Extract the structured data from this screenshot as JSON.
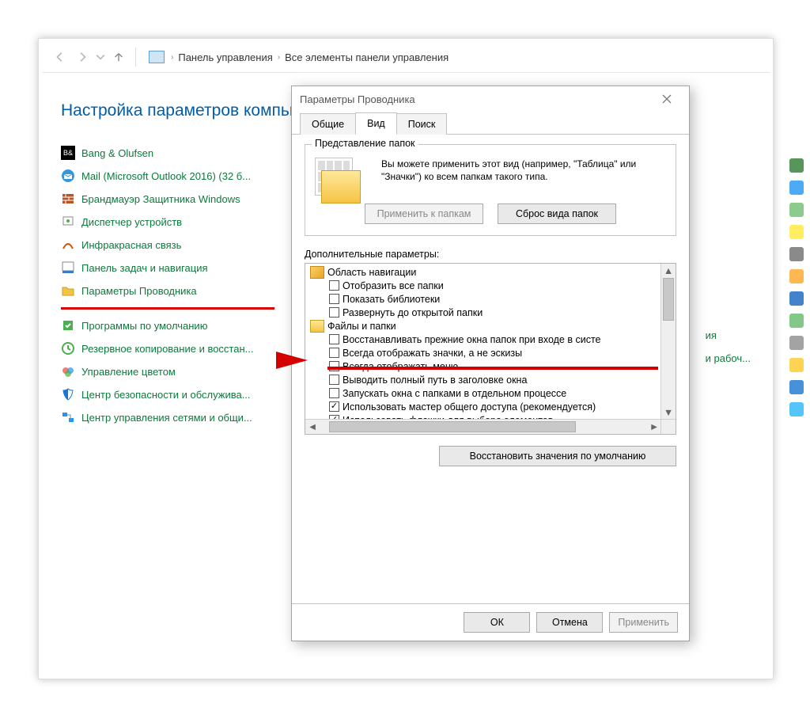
{
  "breadcrumbs": {
    "level1": "Панель управления",
    "level2": "Все элементы панели управления"
  },
  "cp": {
    "heading": "Настройка параметров компьют",
    "links": [
      "Bang & Olufsen",
      "Mail (Microsoft Outlook 2016) (32 б...",
      "Брандмауэр Защитника Windows",
      "Диспетчер устройств",
      "Инфракрасная связь",
      "Панель задач и навигация",
      "Параметры Проводника",
      "Программы по умолчанию",
      "Резервное копирование и восстан...",
      "Управление цветом",
      "Центр безопасности и обслужива...",
      "Центр управления сетями и общи..."
    ],
    "right_cutoff_1": "ия",
    "right_cutoff_2": "и рабоч..."
  },
  "dialog": {
    "title": "Параметры Проводника",
    "tabs": {
      "general": "Общие",
      "view": "Вид",
      "search": "Поиск"
    },
    "group": {
      "legend": "Представление папок",
      "desc": "Вы можете применить этот вид (например, \"Таблица\" или \"Значки\") ко всем папкам такого типа.",
      "apply_btn": "Применить к папкам",
      "reset_btn": "Сброс вида папок"
    },
    "adv_label": "Дополнительные параметры:",
    "tree": {
      "group_nav": "Область навигации",
      "items_nav": [
        {
          "checked": false,
          "label": "Отобразить все папки"
        },
        {
          "checked": false,
          "label": "Показать библиотеки"
        },
        {
          "checked": false,
          "label": "Развернуть до открытой папки"
        }
      ],
      "group_files": "Файлы и папки",
      "items_files": [
        {
          "checked": false,
          "label": "Восстанавливать прежние окна папок при входе в систе"
        },
        {
          "checked": false,
          "label": "Всегда отображать значки, а не эскизы"
        },
        {
          "checked": false,
          "label": "Всегда отображать меню"
        },
        {
          "checked": false,
          "label": "Выводить полный путь в заголовке окна"
        },
        {
          "checked": false,
          "label": "Запускать окна с папками в отдельном процессе"
        },
        {
          "checked": true,
          "label": "Использовать мастер общего доступа (рекомендуется)"
        },
        {
          "checked": true,
          "label": "Использовать флажки для выбора элементов"
        }
      ]
    },
    "restore_btn": "Восстановить значения по умолчанию",
    "ok": "ОК",
    "cancel": "Отмена",
    "apply": "Применить"
  }
}
